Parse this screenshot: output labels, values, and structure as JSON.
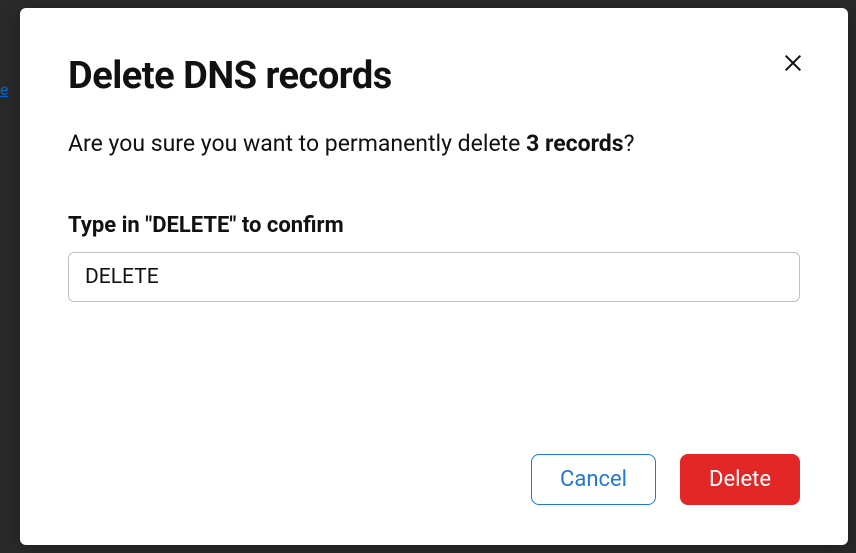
{
  "background": {
    "partial_link": "e"
  },
  "modal": {
    "title": "Delete DNS records",
    "confirm_prefix": "Are you sure you want to permanently delete ",
    "confirm_bold": "3 records",
    "confirm_suffix": "?",
    "field_label": "Type in \"DELETE\" to confirm",
    "input_value": "DELETE",
    "buttons": {
      "cancel": "Cancel",
      "delete": "Delete"
    }
  }
}
